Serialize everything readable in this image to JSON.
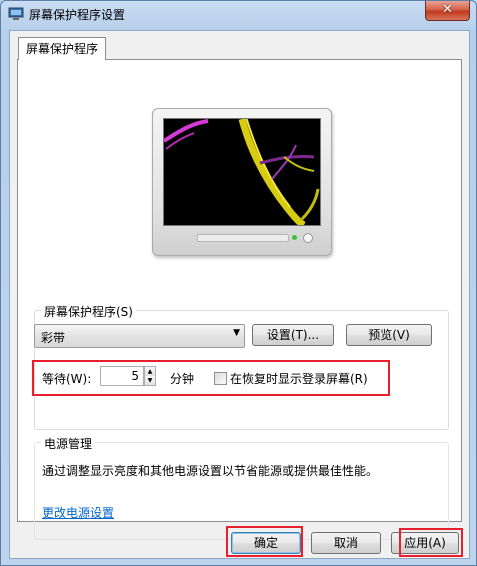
{
  "window": {
    "title": "屏幕保护程序设置",
    "close_glyph": "✕"
  },
  "tab": {
    "label": "屏幕保护程序"
  },
  "screensaver": {
    "group_label": "屏幕保护程序(S)",
    "selected": "彩带",
    "settings_button": "设置(T)...",
    "preview_button": "预览(V)",
    "wait_label": "等待(W):",
    "wait_value": "5",
    "wait_unit": "分钟",
    "resume_checkbox_label": "在恢复时显示登录屏幕(R)",
    "resume_checked": false
  },
  "power": {
    "group_label": "电源管理",
    "description": "通过调整显示亮度和其他电源设置以节省能源或提供最佳性能。",
    "link_text": "更改电源设置"
  },
  "footer": {
    "ok_button": "确定",
    "cancel_button": "取消",
    "apply_button": "应用(A)"
  },
  "colors": {
    "highlight_box": "#e8202d",
    "link": "#0066cc"
  },
  "icons": [
    "app-icon",
    "close-icon",
    "chevron-down-icon",
    "spin-up-icon",
    "spin-down-icon"
  ]
}
